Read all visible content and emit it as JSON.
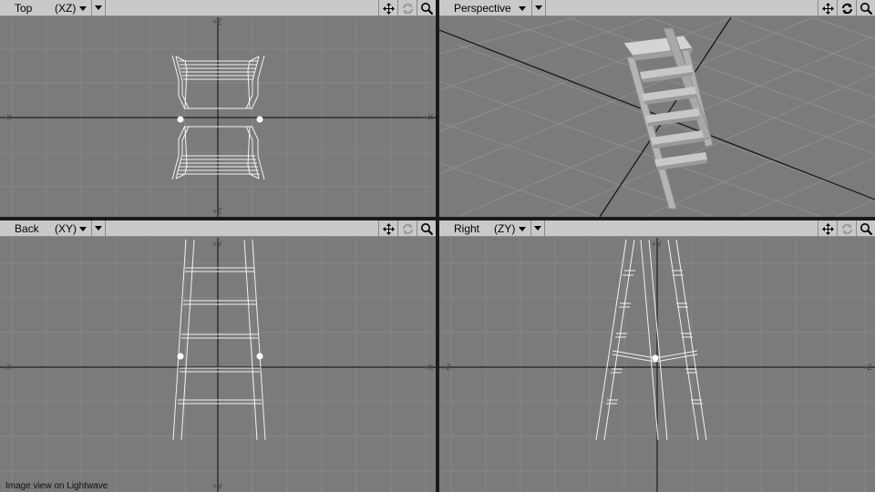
{
  "viewports": {
    "top": {
      "name": "Top",
      "mode": "(XZ)"
    },
    "perspective": {
      "name": "Perspective"
    },
    "back": {
      "name": "Back",
      "mode": "(XY)"
    },
    "right": {
      "name": "Right",
      "mode": "(ZY)"
    }
  },
  "axis_labels": {
    "x": "+X",
    "y": "+Y",
    "z": "+Z"
  },
  "caption": "Image view on Lightwave",
  "icons": [
    "move-view-icon",
    "rotate-view-icon",
    "zoom-view-icon"
  ],
  "colors": {
    "viewport_bg": "#7b7b7b",
    "grid": "#858585",
    "header": "#c9c9c9",
    "wire": "#ffffff",
    "axis": "#1e1e1e"
  }
}
